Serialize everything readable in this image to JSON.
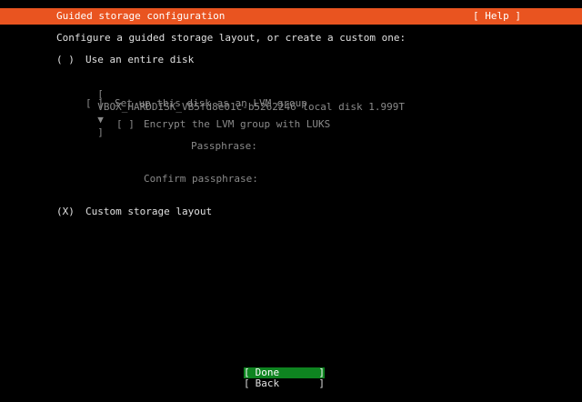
{
  "header": {
    "title": "Guided storage configuration",
    "help_label": "[ Help ]"
  },
  "intro": "Configure a guided storage layout, or create a custom one:",
  "options": {
    "entire_disk": {
      "radio": "( )",
      "label": "Use an entire disk"
    },
    "disk_select": {
      "open": "[",
      "value": "VBOX_HARDDISK_VB5fd8e01c-b5262246 local disk 1.999T",
      "arrow": "▼",
      "close": "]"
    },
    "lvm": {
      "checkbox": "[ ]",
      "label": "Set up this disk as an LVM group"
    },
    "encrypt": {
      "checkbox": "[ ]",
      "label": "Encrypt the LVM group with LUKS"
    },
    "passphrase_label": "Passphrase:",
    "confirm_label": "Confirm passphrase:",
    "custom": {
      "radio": "(X)",
      "label": "Custom storage layout"
    }
  },
  "buttons": {
    "done_open": "[",
    "done": "Done",
    "done_close": "]",
    "back_open": "[",
    "back": "Back",
    "back_close": "]"
  },
  "colors": {
    "header_bg": "#e95420",
    "done_bg": "#0e8420",
    "background": "#000000"
  }
}
